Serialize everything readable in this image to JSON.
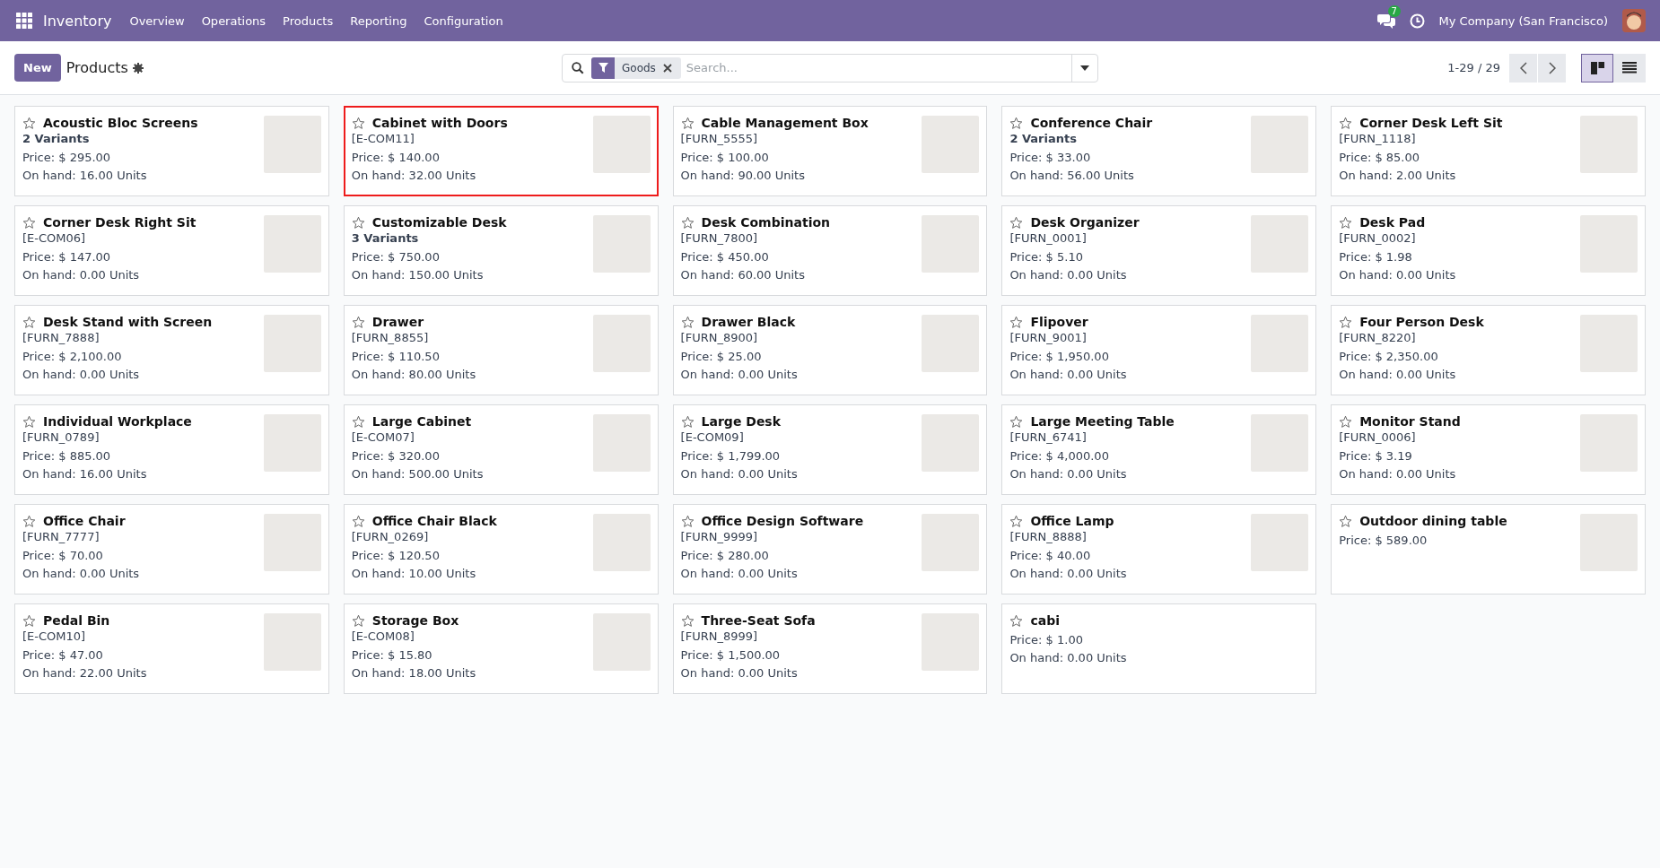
{
  "navbar": {
    "app": "Inventory",
    "menu": [
      "Overview",
      "Operations",
      "Products",
      "Reporting",
      "Configuration"
    ],
    "messages_count": "7",
    "company": "My Company (San Francisco)"
  },
  "control_panel": {
    "new_button": "New",
    "title": "Products",
    "search": {
      "facet": "Goods",
      "placeholder": "Search..."
    },
    "pager": "1-29 / 29",
    "views": [
      {
        "kind": "kanban",
        "selected": true
      },
      {
        "kind": "list",
        "selected": false
      }
    ]
  },
  "products": [
    {
      "name": "Acoustic Bloc Screens",
      "favorite": false,
      "highlighted": false,
      "subtitle": {
        "kind": "variants",
        "text": "2 Variants"
      },
      "price": "Price: $ 295.00",
      "on_hand": "On hand: 16.00 Units",
      "photo": true
    },
    {
      "name": "Cabinet with Doors",
      "favorite": false,
      "highlighted": true,
      "subtitle": {
        "kind": "reference",
        "text": "[E-COM11]"
      },
      "price": "Price: $ 140.00",
      "on_hand": "On hand: 32.00 Units",
      "photo": true
    },
    {
      "name": "Cable Management Box",
      "favorite": false,
      "highlighted": false,
      "subtitle": {
        "kind": "reference",
        "text": "[FURN_5555]"
      },
      "price": "Price: $ 100.00",
      "on_hand": "On hand: 90.00 Units",
      "photo": true
    },
    {
      "name": "Conference Chair",
      "favorite": false,
      "highlighted": false,
      "subtitle": {
        "kind": "variants",
        "text": "2 Variants"
      },
      "price": "Price: $ 33.00",
      "on_hand": "On hand: 56.00 Units",
      "photo": true
    },
    {
      "name": "Corner Desk Left Sit",
      "favorite": false,
      "highlighted": false,
      "subtitle": {
        "kind": "reference",
        "text": "[FURN_1118]"
      },
      "price": "Price: $ 85.00",
      "on_hand": "On hand: 2.00 Units",
      "photo": true
    },
    {
      "name": "Corner Desk Right Sit",
      "favorite": false,
      "highlighted": false,
      "subtitle": {
        "kind": "reference",
        "text": "[E-COM06]"
      },
      "price": "Price: $ 147.00",
      "on_hand": "On hand: 0.00 Units",
      "photo": true
    },
    {
      "name": "Customizable Desk",
      "favorite": false,
      "highlighted": false,
      "subtitle": {
        "kind": "variants",
        "text": "3 Variants"
      },
      "price": "Price: $ 750.00",
      "on_hand": "On hand: 150.00 Units",
      "photo": true
    },
    {
      "name": "Desk Combination",
      "favorite": false,
      "highlighted": false,
      "subtitle": {
        "kind": "reference",
        "text": "[FURN_7800]"
      },
      "price": "Price: $ 450.00",
      "on_hand": "On hand: 60.00 Units",
      "photo": true
    },
    {
      "name": "Desk Organizer",
      "favorite": false,
      "highlighted": false,
      "subtitle": {
        "kind": "reference",
        "text": "[FURN_0001]"
      },
      "price": "Price: $ 5.10",
      "on_hand": "On hand: 0.00 Units",
      "photo": true
    },
    {
      "name": "Desk Pad",
      "favorite": false,
      "highlighted": false,
      "subtitle": {
        "kind": "reference",
        "text": "[FURN_0002]"
      },
      "price": "Price: $ 1.98",
      "on_hand": "On hand: 0.00 Units",
      "photo": true
    },
    {
      "name": "Desk Stand with Screen",
      "favorite": false,
      "highlighted": false,
      "subtitle": {
        "kind": "reference",
        "text": "[FURN_7888]"
      },
      "price": "Price: $ 2,100.00",
      "on_hand": "On hand: 0.00 Units",
      "photo": true
    },
    {
      "name": "Drawer",
      "favorite": false,
      "highlighted": false,
      "subtitle": {
        "kind": "reference",
        "text": "[FURN_8855]"
      },
      "price": "Price: $ 110.50",
      "on_hand": "On hand: 80.00 Units",
      "photo": true
    },
    {
      "name": "Drawer Black",
      "favorite": false,
      "highlighted": false,
      "subtitle": {
        "kind": "reference",
        "text": "[FURN_8900]"
      },
      "price": "Price: $ 25.00",
      "on_hand": "On hand: 0.00 Units",
      "photo": true
    },
    {
      "name": "Flipover",
      "favorite": false,
      "highlighted": false,
      "subtitle": {
        "kind": "reference",
        "text": "[FURN_9001]"
      },
      "price": "Price: $ 1,950.00",
      "on_hand": "On hand: 0.00 Units",
      "photo": true
    },
    {
      "name": "Four Person Desk",
      "favorite": false,
      "highlighted": false,
      "subtitle": {
        "kind": "reference",
        "text": "[FURN_8220]"
      },
      "price": "Price: $ 2,350.00",
      "on_hand": "On hand: 0.00 Units",
      "photo": true
    },
    {
      "name": "Individual Workplace",
      "favorite": false,
      "highlighted": false,
      "subtitle": {
        "kind": "reference",
        "text": "[FURN_0789]"
      },
      "price": "Price: $ 885.00",
      "on_hand": "On hand: 16.00 Units",
      "photo": true
    },
    {
      "name": "Large Cabinet",
      "favorite": false,
      "highlighted": false,
      "subtitle": {
        "kind": "reference",
        "text": "[E-COM07]"
      },
      "price": "Price: $ 320.00",
      "on_hand": "On hand: 500.00 Units",
      "photo": true
    },
    {
      "name": "Large Desk",
      "favorite": false,
      "highlighted": false,
      "subtitle": {
        "kind": "reference",
        "text": "[E-COM09]"
      },
      "price": "Price: $ 1,799.00",
      "on_hand": "On hand: 0.00 Units",
      "photo": true
    },
    {
      "name": "Large Meeting Table",
      "favorite": false,
      "highlighted": false,
      "subtitle": {
        "kind": "reference",
        "text": "[FURN_6741]"
      },
      "price": "Price: $ 4,000.00",
      "on_hand": "On hand: 0.00 Units",
      "photo": true
    },
    {
      "name": "Monitor Stand",
      "favorite": false,
      "highlighted": false,
      "subtitle": {
        "kind": "reference",
        "text": "[FURN_0006]"
      },
      "price": "Price: $ 3.19",
      "on_hand": "On hand: 0.00 Units",
      "photo": true
    },
    {
      "name": "Office Chair",
      "favorite": false,
      "highlighted": false,
      "subtitle": {
        "kind": "reference",
        "text": "[FURN_7777]"
      },
      "price": "Price: $ 70.00",
      "on_hand": "On hand: 0.00 Units",
      "photo": true
    },
    {
      "name": "Office Chair Black",
      "favorite": false,
      "highlighted": false,
      "subtitle": {
        "kind": "reference",
        "text": "[FURN_0269]"
      },
      "price": "Price: $ 120.50",
      "on_hand": "On hand: 10.00 Units",
      "photo": true
    },
    {
      "name": "Office Design Software",
      "favorite": false,
      "highlighted": false,
      "subtitle": {
        "kind": "reference",
        "text": "[FURN_9999]"
      },
      "price": "Price: $ 280.00",
      "on_hand": "On hand: 0.00 Units",
      "photo": true
    },
    {
      "name": "Office Lamp",
      "favorite": false,
      "highlighted": false,
      "subtitle": {
        "kind": "reference",
        "text": "[FURN_8888]"
      },
      "price": "Price: $ 40.00",
      "on_hand": "On hand: 0.00 Units",
      "photo": true
    },
    {
      "name": "Outdoor dining table",
      "favorite": false,
      "highlighted": false,
      "price": "Price: $ 589.00",
      "photo": true
    },
    {
      "name": "Pedal Bin",
      "favorite": false,
      "highlighted": false,
      "subtitle": {
        "kind": "reference",
        "text": "[E-COM10]"
      },
      "price": "Price: $ 47.00",
      "on_hand": "On hand: 22.00 Units",
      "photo": true
    },
    {
      "name": "Storage Box",
      "favorite": false,
      "highlighted": false,
      "subtitle": {
        "kind": "reference",
        "text": "[E-COM08]"
      },
      "price": "Price: $ 15.80",
      "on_hand": "On hand: 18.00 Units",
      "photo": true
    },
    {
      "name": "Three-Seat Sofa",
      "favorite": false,
      "highlighted": false,
      "subtitle": {
        "kind": "reference",
        "text": "[FURN_8999]"
      },
      "price": "Price: $ 1,500.00",
      "on_hand": "On hand: 0.00 Units",
      "photo": true
    },
    {
      "name": "cabi",
      "favorite": false,
      "highlighted": false,
      "price": "Price: $ 1.00",
      "on_hand": "On hand: 0.00 Units",
      "photo": false
    }
  ]
}
